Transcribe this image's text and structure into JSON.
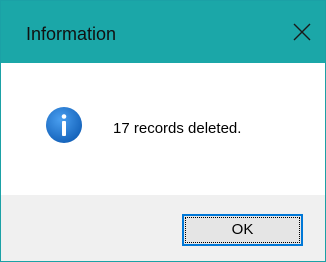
{
  "window": {
    "title": "Information",
    "close_icon": "close-icon"
  },
  "content": {
    "icon": "info-icon",
    "message": "17 records deleted."
  },
  "buttons": {
    "ok_label": "OK"
  },
  "colors": {
    "titlebar": "#1ba7a8",
    "footer": "#f0f0f0",
    "icon_blue": "#1a73c8",
    "button_focus_border": "#0078d7"
  }
}
